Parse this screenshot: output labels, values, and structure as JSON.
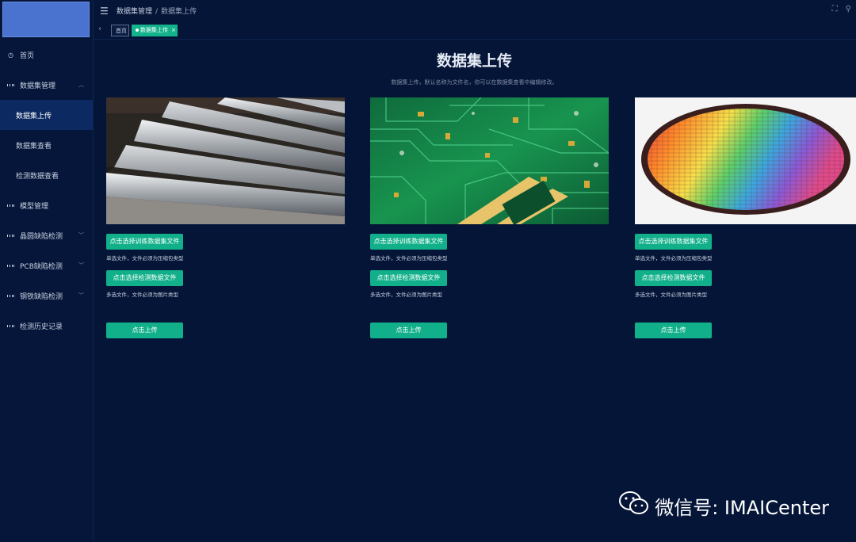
{
  "topbar": {
    "breadcrumb": [
      "数据集管理",
      "数据集上传"
    ],
    "separator": "/"
  },
  "tabs": {
    "home": "首页",
    "current": "数据集上传",
    "close": "×"
  },
  "sidebar": {
    "items": [
      {
        "label": "首页",
        "icon": "clock-icon"
      },
      {
        "label": "数据集管理",
        "icon": "grid-icon"
      },
      {
        "label": "数据集上传"
      },
      {
        "label": "数据集查看"
      },
      {
        "label": "检测数据查看"
      },
      {
        "label": "模型管理",
        "icon": "grid-icon"
      },
      {
        "label": "晶圆缺陷检测",
        "icon": "grid-icon"
      },
      {
        "label": "PCB缺陷检测",
        "icon": "grid-icon"
      },
      {
        "label": "钢铁缺陷检测",
        "icon": "grid-icon"
      },
      {
        "label": "检测历史记录",
        "icon": "grid-icon"
      }
    ]
  },
  "main": {
    "title": "数据集上传",
    "subtitle": "数据集上传，默认名称为文件名，你可以在数据集查看中编辑修改。",
    "cards": [
      {
        "image": "steel",
        "train_btn": "点击选择训练数据集文件",
        "train_hint": "单选文件，文件必须为压缩包类型",
        "detect_btn": "点击选择检测数据文件",
        "detect_hint": "多选文件，文件必须为图片类型",
        "upload_btn": "点击上传"
      },
      {
        "image": "pcb",
        "train_btn": "点击选择训练数据集文件",
        "train_hint": "单选文件，文件必须为压缩包类型",
        "detect_btn": "点击选择检测数据文件",
        "detect_hint": "多选文件，文件必须为图片类型",
        "upload_btn": "点击上传"
      },
      {
        "image": "wafer",
        "train_btn": "点击选择训练数据集文件",
        "train_hint": "单选文件，文件必须为压缩包类型",
        "detect_btn": "点击选择检测数据文件",
        "detect_hint": "多选文件，文件必须为图片类型",
        "upload_btn": "点击上传"
      }
    ]
  },
  "watermark": {
    "text": "微信号: IMAICenter"
  },
  "colors": {
    "bg": "#051537",
    "sidebar": "#06163a",
    "active": "#0c2a61",
    "accent": "#12b08a",
    "logo": "#4a73d0"
  }
}
